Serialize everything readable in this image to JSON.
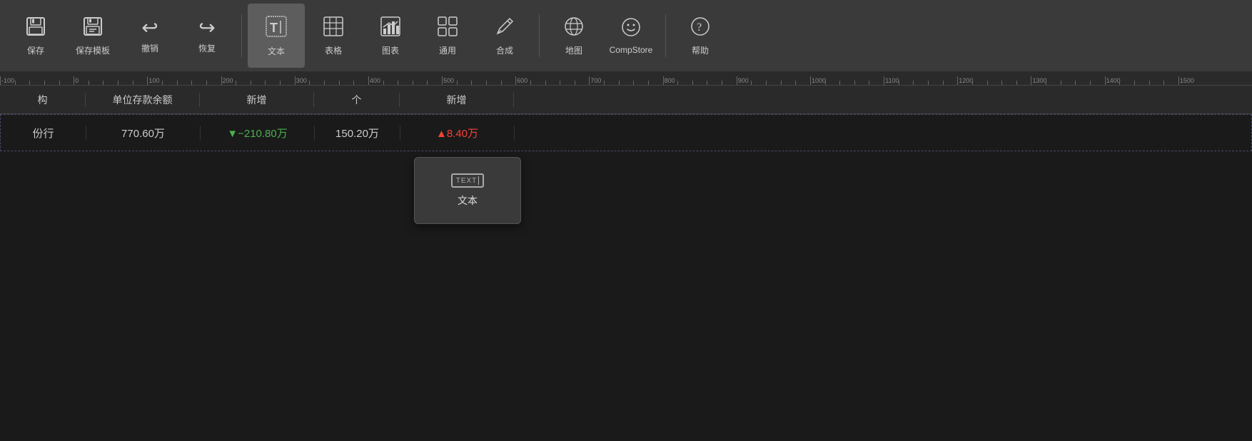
{
  "toolbar": {
    "items": [
      {
        "id": "save",
        "label": "保存",
        "icon": "💾"
      },
      {
        "id": "save-template",
        "label": "保存模板",
        "icon": "🖫"
      },
      {
        "id": "undo",
        "label": "撤销",
        "icon": "↩"
      },
      {
        "id": "redo",
        "label": "恢复",
        "icon": "↪"
      },
      {
        "id": "text",
        "label": "文本",
        "icon": "⊞T",
        "active": true
      },
      {
        "id": "table",
        "label": "表格",
        "icon": "⊞"
      },
      {
        "id": "chart",
        "label": "图表",
        "icon": "📊"
      },
      {
        "id": "general",
        "label": "通用",
        "icon": "⊞⊞"
      },
      {
        "id": "compose",
        "label": "合成",
        "icon": "✏"
      },
      {
        "id": "map",
        "label": "地图",
        "icon": "🌐"
      },
      {
        "id": "compstore",
        "label": "CompStore",
        "icon": "☺"
      },
      {
        "id": "help",
        "label": "帮助",
        "icon": "?"
      }
    ],
    "divider1_after": 3,
    "divider2_after": 10
  },
  "ruler": {
    "ticks": [
      0,
      100,
      200,
      300,
      400,
      500,
      600,
      700,
      800,
      900,
      1000,
      1100,
      1200,
      1300,
      1400,
      1500
    ]
  },
  "table": {
    "headers": [
      "构",
      "单位存款余额",
      "新增",
      "个",
      "新增"
    ],
    "rows": [
      {
        "col1": "份行",
        "col2": "770.60万",
        "col3": "▼−210.80万",
        "col3_color": "down",
        "col4": "150.20万",
        "col5": "▲8.40万",
        "col5_color": "up"
      }
    ]
  },
  "dropdown": {
    "items": [
      {
        "id": "text-item",
        "label": "文本",
        "icon_text": "TEXT",
        "has_cursor": true
      }
    ]
  }
}
